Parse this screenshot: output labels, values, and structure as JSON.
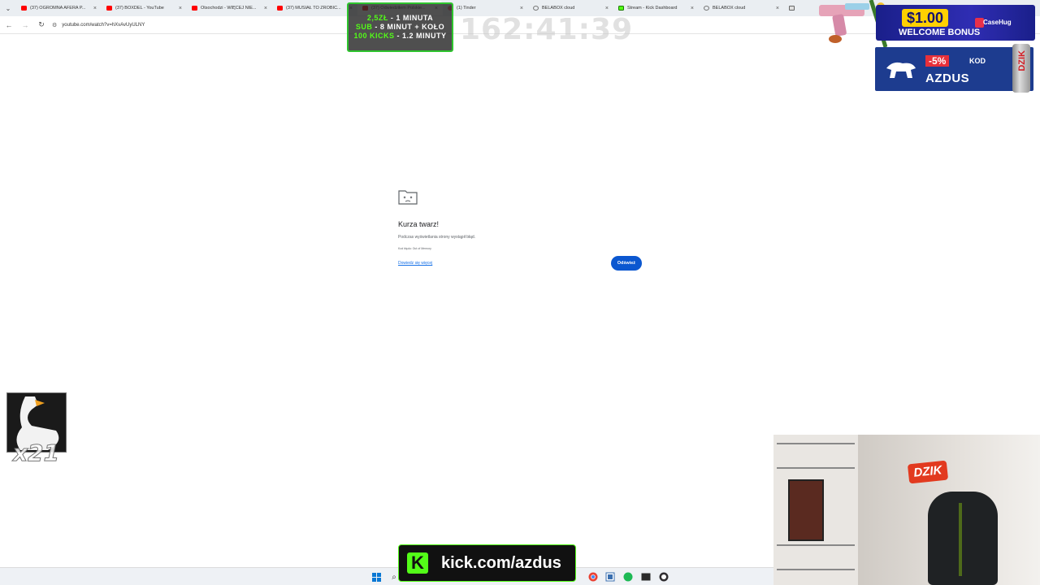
{
  "browser": {
    "tabs": [
      {
        "title": "(37) OGROMNA AFERA P...",
        "icon": "youtube-icon",
        "active": false
      },
      {
        "title": "(37) BOXDEL - YouTube",
        "icon": "youtube-icon",
        "active": false
      },
      {
        "title": "Otsochodzi - WIĘCEJ NIE...",
        "icon": "youtube-icon",
        "active": false
      },
      {
        "title": "(37) MUSIAŁ TO ZROBIĆ...",
        "icon": "youtube-icon",
        "active": false
      },
      {
        "title": "(37) Odwiedziłem Polskie...",
        "icon": "youtube-icon",
        "active": true
      },
      {
        "title": "(1) Tinder",
        "icon": "tinder-icon",
        "active": false
      },
      {
        "title": "BELABOX cloud",
        "icon": "globe-icon",
        "active": false
      },
      {
        "title": "Stream - Kick Dashboard",
        "icon": "kick-icon",
        "active": false
      },
      {
        "title": "BELABOX cloud",
        "icon": "globe-icon",
        "active": false
      },
      {
        "title": "",
        "icon": "doc-icon",
        "active": false
      }
    ],
    "close_glyph": "×",
    "url": "youtube.com/watch?v=hXvAvUyULNY"
  },
  "error_page": {
    "title": "Kurza twarz!",
    "description": "Podczas wyświetlania strony wystąpił błąd.",
    "error_code": "Kod błędu: Out of Memory",
    "learn_more": "Dowiedz się więcej",
    "reload_label": "Odśwież"
  },
  "overlay": {
    "sub_goals": [
      {
        "highlight": "2,5ZŁ",
        "text": " - 1 MINUTA"
      },
      {
        "highlight": "SUB",
        "text": " - 8 MINUT + KOŁO"
      },
      {
        "highlight": "100 KICKS",
        "text": " - 1.2 MINUTY"
      }
    ],
    "timer": "162:41:39",
    "casino_ad": {
      "price": "$1.00",
      "bonus": "WELCOME BONUS",
      "brand": "CaseHug"
    },
    "code_ad": {
      "discount": "-5%",
      "kod": "KOD",
      "code": "AZDUS",
      "can_label": "DZIK"
    },
    "multiplier": "x21",
    "cam_logo": "DZIK",
    "kick_url": "kick.com/azdus",
    "kick_logo": "K"
  },
  "colors": {
    "accent_blue": "#0b57d0",
    "kick_green": "#53fc18"
  }
}
